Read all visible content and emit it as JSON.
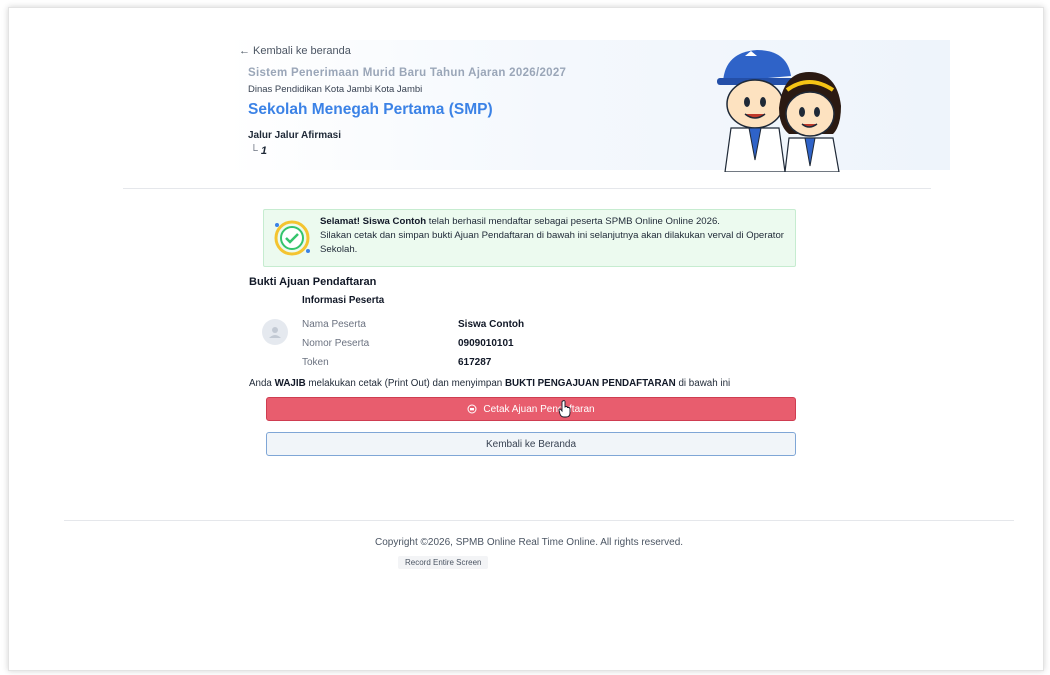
{
  "header": {
    "back_link": "← Kembali ke beranda",
    "subtitle": "Sistem Penerimaan Murid Baru  Tahun Ajaran 2026/2027",
    "dinas": "Dinas Pendidikan Kota Jambi Kota Jambi",
    "title": "Sekolah Menegah Pertama (SMP)",
    "jalur": "Jalur Jalur Afirmasi",
    "tree_prefix": "└ ",
    "tree_value": "1"
  },
  "alert": {
    "lead": "Selamat!",
    "student": "Siswa Contoh",
    "line1_rest": "telah berhasil mendaftar sebagai peserta SPMB Online Online 2026.",
    "line2": "Silakan cetak dan simpan bukti Ajuan Pendaftaran di bawah ini selanjutnya akan dilakukan verval di Operator Sekolah."
  },
  "bukti": {
    "title": "Bukti Ajuan Pendaftaran",
    "info_title": "Informasi Peserta",
    "rows": [
      {
        "label": "Nama Peserta",
        "value": "Siswa Contoh"
      },
      {
        "label": "Nomor Peserta",
        "value": "0909010101"
      },
      {
        "label": "Token",
        "value": "617287"
      }
    ]
  },
  "notice": {
    "pre": "Anda",
    "wajib": "WAJIB",
    "mid": "melakukan cetak (Print Out) dan menyimpan",
    "bukti": "BUKTI PENGAJUAN PENDAFTARAN",
    "post": "di bawah ini"
  },
  "buttons": {
    "print_label": "Cetak Ajuan Pendaftaran",
    "back_label": "Kembali ke Beranda"
  },
  "footer": {
    "copyright": "Copyright ©2026, SPMB Online Real Time Online. All rights reserved.",
    "record_chip": "Record Entire Screen"
  },
  "colors": {
    "accent_blue": "#3b82e6",
    "print_red": "#e85d6e",
    "success_bg": "#ecfaef"
  },
  "icons": {
    "alert": "check-circle-icon",
    "avatar": "user-avatar-icon",
    "print": "print-icon",
    "mascot": "student-mascot-illustration"
  }
}
